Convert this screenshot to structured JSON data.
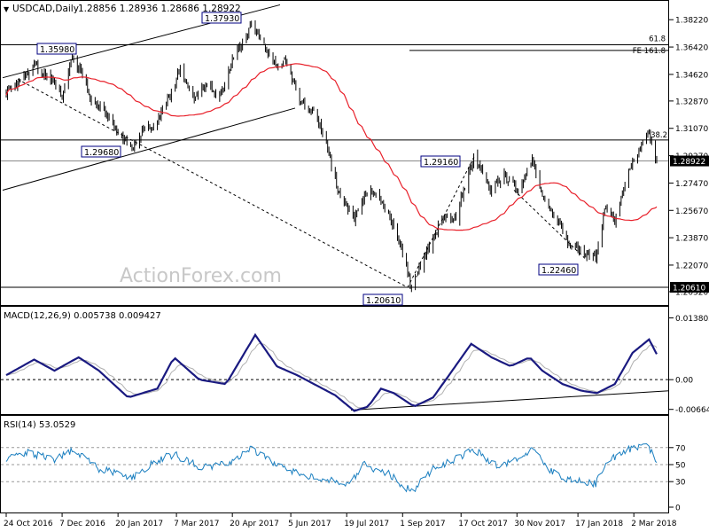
{
  "header": {
    "symbol": "USDCAD,Daily",
    "quote": "1.28856 1.28936 1.28686 1.28922",
    "menu_glyph": "▼"
  },
  "watermark": "ActionForex.com",
  "colors": {
    "candle": "#000000",
    "ma": "#e8202a",
    "macd": "#1a1a80",
    "macd_signal": "#b0b0b0",
    "rsi": "#1b7fc0",
    "grid": "#000000",
    "label_border": "#000080"
  },
  "chart_data": [
    {
      "type": "candlestick",
      "ylim": [
        1.195,
        1.394
      ],
      "y_ticks": [
        "1.38220",
        "1.36420",
        "1.34620",
        "1.32870",
        "1.31070",
        "1.29270",
        "1.27470",
        "1.25670",
        "1.23870",
        "1.22070",
        "1.20320"
      ],
      "x_labels": [
        "24 Oct 2016",
        "7 Dec 2016",
        "20 Jan 2017",
        "7 Mar 2017",
        "20 Apr 2017",
        "5 Jun 2017",
        "19 Jul 2017",
        "1 Sep 2017",
        "17 Oct 2017",
        "30 Nov 2017",
        "17 Jan 2018",
        "2 Mar 2018"
      ],
      "price_anchors": [
        [
          "2016-10-24",
          1.335
        ],
        [
          "2016-11-15",
          1.352
        ],
        [
          "2016-12-01",
          1.34
        ],
        [
          "2016-12-07",
          1.33
        ],
        [
          "2016-12-15",
          1.3598
        ],
        [
          "2016-12-30",
          1.33
        ],
        [
          "2017-01-10",
          1.32
        ],
        [
          "2017-01-31",
          1.2968
        ],
        [
          "2017-02-10",
          1.31
        ],
        [
          "2017-02-20",
          1.315
        ],
        [
          "2017-03-01",
          1.33
        ],
        [
          "2017-03-10",
          1.35
        ],
        [
          "2017-03-20",
          1.33
        ],
        [
          "2017-04-01",
          1.34
        ],
        [
          "2017-04-10",
          1.33
        ],
        [
          "2017-04-20",
          1.355
        ],
        [
          "2017-05-05",
          1.3793
        ],
        [
          "2017-05-15",
          1.365
        ],
        [
          "2017-05-25",
          1.35
        ],
        [
          "2017-06-01",
          1.355
        ],
        [
          "2017-06-12",
          1.33
        ],
        [
          "2017-06-25",
          1.32
        ],
        [
          "2017-07-05",
          1.295
        ],
        [
          "2017-07-12",
          1.27
        ],
        [
          "2017-07-25",
          1.25
        ],
        [
          "2017-08-05",
          1.27
        ],
        [
          "2017-08-12",
          1.265
        ],
        [
          "2017-08-20",
          1.255
        ],
        [
          "2017-08-28",
          1.24
        ],
        [
          "2017-09-08",
          1.2061
        ],
        [
          "2017-09-20",
          1.23
        ],
        [
          "2017-10-05",
          1.255
        ],
        [
          "2017-10-12",
          1.25
        ],
        [
          "2017-10-27",
          1.2916
        ],
        [
          "2017-11-10",
          1.27
        ],
        [
          "2017-11-20",
          1.28
        ],
        [
          "2017-12-01",
          1.27
        ],
        [
          "2017-12-12",
          1.29
        ],
        [
          "2017-12-20",
          1.265
        ],
        [
          "2018-01-01",
          1.25
        ],
        [
          "2018-01-10",
          1.235
        ],
        [
          "2018-01-20",
          1.23
        ],
        [
          "2018-01-31",
          1.2246
        ],
        [
          "2018-02-08",
          1.26
        ],
        [
          "2018-02-15",
          1.25
        ],
        [
          "2018-02-25",
          1.28
        ],
        [
          "2018-03-05",
          1.295
        ],
        [
          "2018-03-12",
          1.31
        ],
        [
          "2018-03-20",
          1.2892
        ]
      ],
      "annotations": [
        "1.37930",
        "1.35980",
        "1.29680",
        "1.29160",
        "1.22460",
        "1.20610"
      ],
      "fib_labels": [
        "61.8",
        "FE 161.8",
        "38.2"
      ],
      "fib_levels": [
        1.3657,
        1.362,
        1.303
      ],
      "current_price": "1.28922",
      "low_price": "1.20610"
    },
    {
      "type": "line",
      "title": "MACD(12,26,9) 0.005738 0.009427",
      "ylim": [
        -0.0075,
        0.0155
      ],
      "y_ticks": [
        "0.013802",
        "0.00",
        "-0.006648"
      ],
      "macd_anchors": [
        [
          "2016-10-24",
          0.001
        ],
        [
          "2016-11-15",
          0.0045
        ],
        [
          "2016-12-01",
          0.002
        ],
        [
          "2016-12-20",
          0.005
        ],
        [
          "2017-01-05",
          0.002
        ],
        [
          "2017-01-28",
          -0.004
        ],
        [
          "2017-02-20",
          -0.002
        ],
        [
          "2017-03-05",
          0.005
        ],
        [
          "2017-03-25",
          0.0
        ],
        [
          "2017-04-15",
          -0.001
        ],
        [
          "2017-05-08",
          0.01
        ],
        [
          "2017-05-25",
          0.003
        ],
        [
          "2017-06-10",
          0.001
        ],
        [
          "2017-07-10",
          -0.0035
        ],
        [
          "2017-07-25",
          -0.007
        ],
        [
          "2017-08-05",
          -0.006
        ],
        [
          "2017-08-15",
          -0.002
        ],
        [
          "2017-08-25",
          -0.003
        ],
        [
          "2017-09-10",
          -0.006
        ],
        [
          "2017-09-25",
          -0.004
        ],
        [
          "2017-10-10",
          0.002
        ],
        [
          "2017-10-25",
          0.008
        ],
        [
          "2017-11-10",
          0.005
        ],
        [
          "2017-11-25",
          0.003
        ],
        [
          "2017-12-10",
          0.005
        ],
        [
          "2017-12-20",
          0.002
        ],
        [
          "2018-01-05",
          -0.001
        ],
        [
          "2018-01-20",
          -0.0025
        ],
        [
          "2018-02-01",
          -0.003
        ],
        [
          "2018-02-15",
          -0.001
        ],
        [
          "2018-03-01",
          0.006
        ],
        [
          "2018-03-14",
          0.009
        ],
        [
          "2018-03-20",
          0.0057
        ]
      ],
      "signal_value": 0.009427
    },
    {
      "type": "line",
      "title": "RSI(14) 53.0529",
      "ylim": [
        0,
        100
      ],
      "y_ticks": [
        "70",
        "50",
        "30",
        "0"
      ],
      "rsi_anchors": [
        [
          "2016-10-24",
          58
        ],
        [
          "2016-11-10",
          65
        ],
        [
          "2016-12-01",
          55
        ],
        [
          "2016-12-15",
          68
        ],
        [
          "2017-01-05",
          45
        ],
        [
          "2017-01-31",
          35
        ],
        [
          "2017-02-20",
          55
        ],
        [
          "2017-03-05",
          62
        ],
        [
          "2017-03-25",
          48
        ],
        [
          "2017-04-15",
          50
        ],
        [
          "2017-05-05",
          70
        ],
        [
          "2017-05-25",
          48
        ],
        [
          "2017-06-15",
          38
        ],
        [
          "2017-07-10",
          30
        ],
        [
          "2017-07-20",
          25
        ],
        [
          "2017-08-01",
          50
        ],
        [
          "2017-08-20",
          40
        ],
        [
          "2017-09-08",
          18
        ],
        [
          "2017-09-25",
          45
        ],
        [
          "2017-10-10",
          55
        ],
        [
          "2017-10-27",
          68
        ],
        [
          "2017-11-15",
          48
        ],
        [
          "2017-12-01",
          58
        ],
        [
          "2017-12-12",
          68
        ],
        [
          "2017-12-25",
          45
        ],
        [
          "2018-01-10",
          32
        ],
        [
          "2018-01-31",
          28
        ],
        [
          "2018-02-10",
          55
        ],
        [
          "2018-02-25",
          68
        ],
        [
          "2018-03-12",
          74
        ],
        [
          "2018-03-20",
          53
        ]
      ]
    }
  ]
}
